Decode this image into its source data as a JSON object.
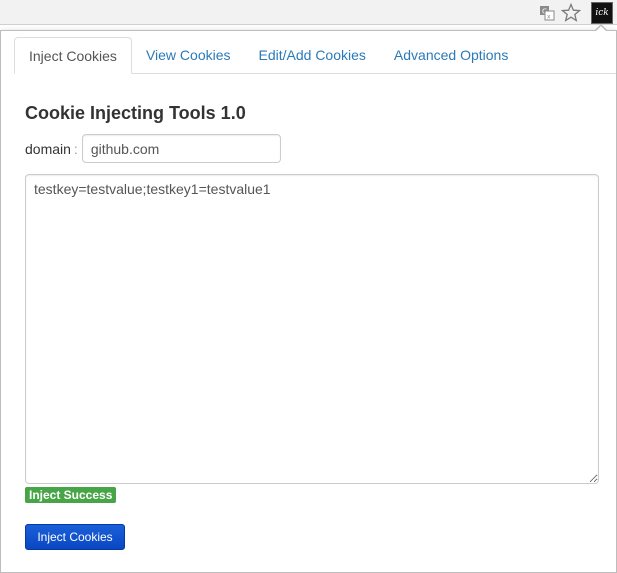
{
  "browser": {
    "icons": [
      "translate-icon",
      "star-icon",
      "extension-icon"
    ],
    "extension_badge_text": "ick"
  },
  "tabs": [
    {
      "label": "Inject Cookies",
      "active": true
    },
    {
      "label": "View Cookies",
      "active": false
    },
    {
      "label": "Edit/Add Cookies",
      "active": false
    },
    {
      "label": "Advanced Options",
      "active": false
    }
  ],
  "main": {
    "title": "Cookie Injecting Tools 1.0",
    "domain_label": "domain",
    "domain_separator": ":",
    "domain_value": "github.com",
    "cookies_value": "testkey=testvalue;testkey1=testvalue1",
    "status_text": "Inject Success",
    "inject_button_label": "Inject Cookies"
  },
  "colors": {
    "link": "#2a7ab9",
    "success": "#47a447",
    "button": "#0a48c3"
  }
}
